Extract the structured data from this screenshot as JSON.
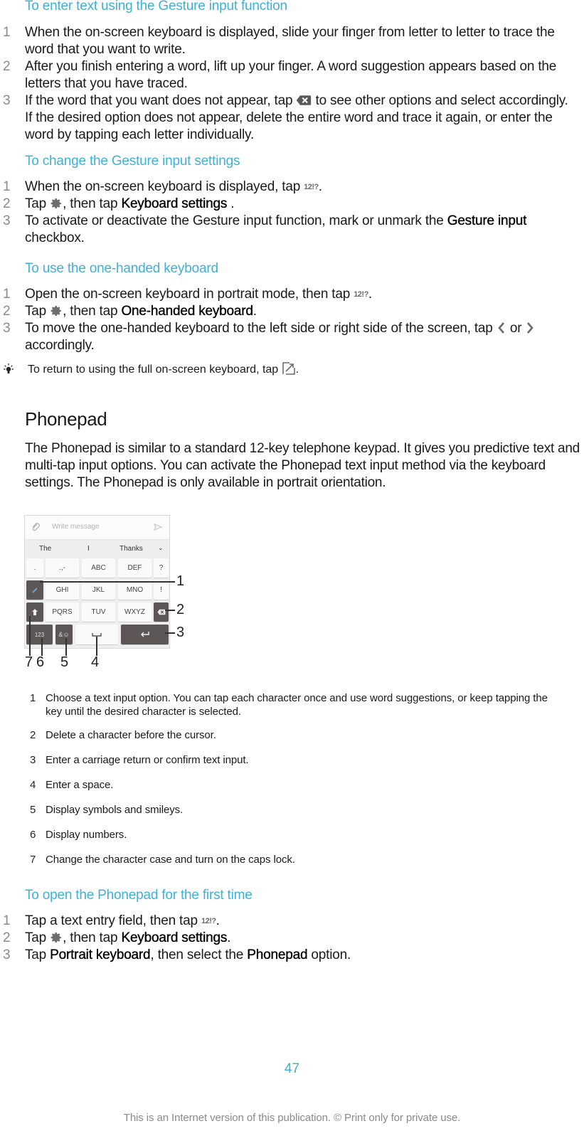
{
  "section_gesture_enter": {
    "heading": "To enter text using the Gesture input function",
    "steps": [
      {
        "num": "1",
        "text": "When the on-screen keyboard is displayed, slide your finger from letter to letter to trace the word that you want to write."
      },
      {
        "num": "2",
        "text": "After you finish entering a word, lift up your finger. A word suggestion appears based on the letters that you have traced."
      },
      {
        "num": "3",
        "text_before": "If the word that you want does not appear, tap",
        "icon": "backspace-icon",
        "text_after": "to see other options and select accordingly. If the desired option does not appear, delete the entire word and trace it again, or enter the word by tapping each letter individually."
      }
    ]
  },
  "section_gesture_settings": {
    "heading": "To change the Gesture input settings",
    "steps": [
      {
        "num": "1",
        "text_before": "When the on-screen keyboard is displayed, tap",
        "icon_text": "12!?",
        "text_after": "."
      },
      {
        "num": "2",
        "text_before": "Tap",
        "icon": "gear-icon",
        "text_mid": ", then tap",
        "bold": "Keyboard settings",
        "text_after": " ."
      },
      {
        "num": "3",
        "text_before": "To activate or deactivate the Gesture input function, mark or unmark the",
        "bold": "Gesture input",
        "text_after": "checkbox."
      }
    ]
  },
  "section_one_handed": {
    "heading": "To use the one-handed keyboard",
    "steps": [
      {
        "num": "1",
        "text_before": "Open the on-screen keyboard in portrait mode, then tap",
        "icon_text": "12!?",
        "text_after": "."
      },
      {
        "num": "2",
        "text_before": "Tap",
        "icon": "gear-icon",
        "text_mid": ", then tap",
        "bold": "One-handed keyboard",
        "text_after": "."
      },
      {
        "num": "3",
        "text_before": "To move the one-handed keyboard to the left side or right side of the screen, tap",
        "text_mid": "or",
        "text_after": "accordingly."
      }
    ],
    "tip": {
      "text_before": "To return to using the full on-screen keyboard, tap",
      "text_after": "."
    }
  },
  "phonepad": {
    "title": "Phonepad",
    "description": "The Phonepad is similar to a standard 12-key telephone keypad. It gives you predictive text and multi-tap input options. You can activate the Phonepad text input method via the keyboard settings. The Phonepad is only available in portrait orientation.",
    "illustration": {
      "placeholder": "Write message",
      "suggestions": [
        "The",
        "I",
        "Thanks"
      ],
      "keys_row1": [
        ".",
        ".,-",
        "ABC",
        "DEF",
        "?"
      ],
      "keys_row2": [
        "GHI",
        "JKL",
        "MNO",
        "!"
      ],
      "keys_row3": [
        "PQRS",
        "TUV",
        "WXYZ"
      ],
      "keys_row4": [
        "123",
        "&☺"
      ],
      "callouts": [
        "1",
        "2",
        "3",
        "4",
        "5",
        "6",
        "7"
      ]
    },
    "legend": [
      {
        "num": "1",
        "text": "Choose a text input option. You can tap each character once and use word suggestions, or keep tapping the key until the desired character is selected."
      },
      {
        "num": "2",
        "text": "Delete a character before the cursor."
      },
      {
        "num": "3",
        "text": "Enter a carriage return or confirm text input."
      },
      {
        "num": "4",
        "text": "Enter a space."
      },
      {
        "num": "5",
        "text": "Display symbols and smileys."
      },
      {
        "num": "6",
        "text": "Display numbers."
      },
      {
        "num": "7",
        "text": "Change the character case and turn on the caps lock."
      }
    ]
  },
  "section_open_phonepad": {
    "heading": "To open the Phonepad for the first time",
    "steps": [
      {
        "num": "1",
        "text_before": "Tap a text entry field, then tap",
        "icon_text": "12!?",
        "text_after": "."
      },
      {
        "num": "2",
        "text_before": "Tap",
        "icon": "gear-icon",
        "text_mid": ", then tap",
        "bold": "Keyboard settings",
        "text_after": "."
      },
      {
        "num": "3",
        "text_before": "Tap",
        "bold": "Portrait keyboard",
        "text_mid": ", then select the",
        "bold2": "Phonepad",
        "text_after": "option."
      }
    ]
  },
  "footer": {
    "page_number": "47",
    "notice": "This is an Internet version of this publication. © Print only for private use."
  },
  "colors": {
    "heading_accent": "#3eb1d6",
    "step_number": "#8a8a8a",
    "icon_gray": "#6a6a6a"
  }
}
